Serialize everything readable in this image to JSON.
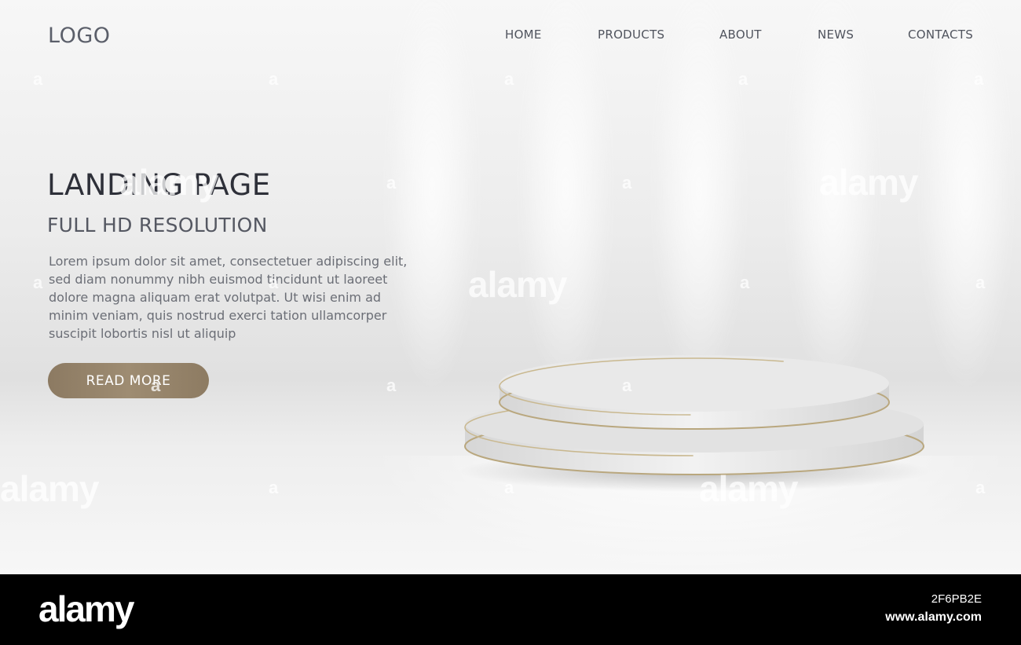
{
  "header": {
    "logo": "LOGO",
    "nav": [
      "HOME",
      "PRODUCTS",
      "ABOUT",
      "NEWS",
      "CONTACTS"
    ]
  },
  "hero": {
    "title": "LANDING PAGE",
    "subtitle": "FULL HD RESOLUTION",
    "body": "Lorem ipsum dolor sit amet, consectetuer adipiscing elit, sed diam nonummy nibh euismod tincidunt ut laoreet dolore magna aliquam erat volutpat. Ut wisi enim ad minim veniam, quis nostrud exerci tation ullamcorper suscipit lobortis nisl ut aliquip",
    "button": "READ MORE"
  },
  "watermark": {
    "text": "alamy",
    "mark": "a"
  },
  "footer": {
    "brand": "alamy",
    "image_id": "2F6PB2E",
    "url": "www.alamy.com"
  },
  "colors": {
    "button": "#9a876d",
    "podium_trim": "#b9a77e",
    "footer": "#000000"
  }
}
